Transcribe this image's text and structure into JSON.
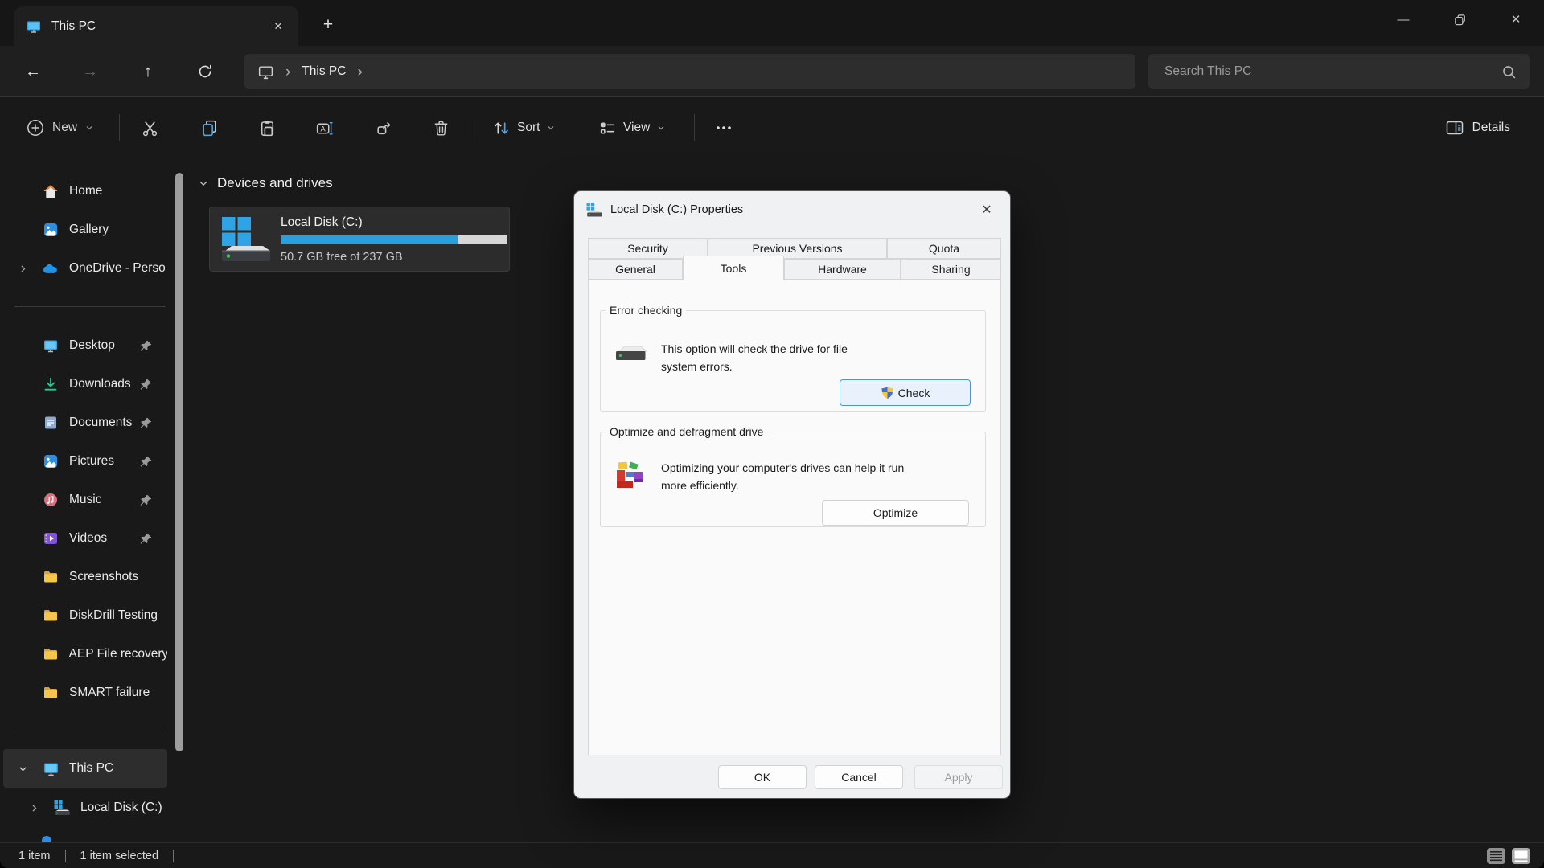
{
  "glyphs": {
    "close": "✕",
    "minimize": "—",
    "plus": "+",
    "back": "←",
    "forward": "→",
    "up": "↑",
    "chevron_right": "›"
  },
  "tab": {
    "title": "This PC"
  },
  "navbar": {
    "breadcrumb": [
      {
        "label": "This PC"
      }
    ],
    "search_placeholder": "Search This PC"
  },
  "toolbar": {
    "new_label": "New",
    "sort_label": "Sort",
    "view_label": "View",
    "details_label": "Details"
  },
  "sidebar": {
    "items": [
      {
        "label": "Home"
      },
      {
        "label": "Gallery"
      },
      {
        "label": "OneDrive - Perso"
      },
      {
        "label": "Desktop",
        "pinned": true
      },
      {
        "label": "Downloads",
        "pinned": true
      },
      {
        "label": "Documents",
        "pinned": true
      },
      {
        "label": "Pictures",
        "pinned": true
      },
      {
        "label": "Music",
        "pinned": true
      },
      {
        "label": "Videos",
        "pinned": true
      },
      {
        "label": "Screenshots"
      },
      {
        "label": "DiskDrill Testing"
      },
      {
        "label": "AEP File recovery"
      },
      {
        "label": "SMART failure"
      },
      {
        "label": "This PC",
        "selected": true
      },
      {
        "label": "Local Disk (C:)"
      }
    ]
  },
  "main": {
    "section_header": "Devices and drives",
    "drive": {
      "name": "Local Disk (C:)",
      "free_text": "50.7 GB free of 237 GB",
      "usage_percent": 78.5,
      "fill_style": "width:78.5%;background:#29a0dd",
      "bar_color": "#29a0dd"
    }
  },
  "dialog": {
    "title": "Local Disk (C:) Properties",
    "tabs_back": [
      "Security",
      "Previous Versions",
      "Quota"
    ],
    "tabs_front": [
      "General",
      "Tools",
      "Hardware",
      "Sharing"
    ],
    "active_tab": "Tools",
    "error_checking": {
      "legend": "Error checking",
      "line1": "This option will check the drive for file",
      "line2": "system errors.",
      "button_label": "Check"
    },
    "optimize": {
      "legend": "Optimize and defragment drive",
      "line1": "Optimizing your computer's drives can help it run",
      "line2": "more efficiently.",
      "button_label": "Optimize"
    },
    "footer": {
      "ok": "OK",
      "cancel": "Cancel",
      "apply": "Apply"
    }
  },
  "statusbar": {
    "items_count": "1 item",
    "selected_count": "1 item selected"
  },
  "colors": {
    "accent_blue": "#29a0dd",
    "selection_bg": "#2d2d2d",
    "dialog_bg": "#eff1f2"
  }
}
